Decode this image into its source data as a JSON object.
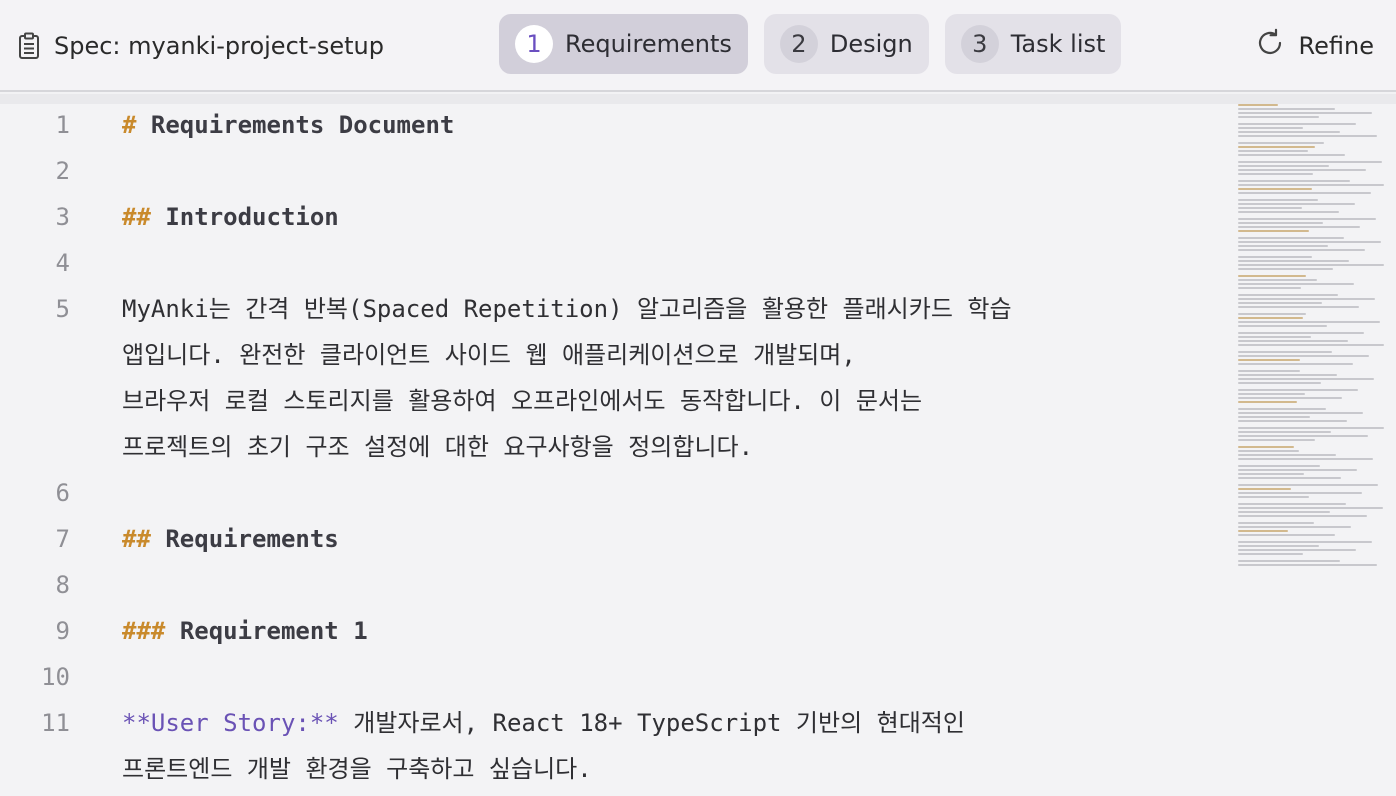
{
  "header": {
    "spec_label": "Spec: myanki-project-setup",
    "steps": [
      {
        "num": "1",
        "label": "Requirements",
        "active": true
      },
      {
        "num": "2",
        "label": "Design",
        "active": false
      },
      {
        "num": "3",
        "label": "Task list",
        "active": false
      }
    ],
    "refine_label": "Refine"
  },
  "editor": {
    "line_numbers": [
      "1",
      "2",
      "3",
      "4",
      "5",
      "6",
      "7",
      "8",
      "9",
      "10",
      "11"
    ],
    "lines": {
      "l1_marker": "#",
      "l1_text": "Requirements Document",
      "l3_marker": "##",
      "l3_text": "Introduction",
      "l5_a": "MyAnki는 간격 반복(Spaced Repetition) 알고리즘을 활용한 플래시카드 학습",
      "l5_b": "앱입니다. 완전한 클라이언트 사이드 웹 애플리케이션으로 개발되며,",
      "l5_c": "브라우저 로컬 스토리지를 활용하여 오프라인에서도 동작합니다. 이 문서는",
      "l5_d": "프로젝트의 초기 구조 설정에 대한 요구사항을 정의합니다.",
      "l7_marker": "##",
      "l7_text": "Requirements",
      "l9_marker": "###",
      "l9_text": "Requirement 1",
      "l11_bold": "**User Story:**",
      "l11_a": "개발자로서, React 18+ TypeScript 기반의 현대적인",
      "l11_b": "프론트엔드 개발 환경을 구축하고 싶습니다."
    }
  },
  "colors": {
    "markdown_marker": "#c98a2c",
    "bold_text": "#6a52b5",
    "active_step_number": "#6a4fc0"
  },
  "icons": {
    "spec": "clipboard-icon",
    "refine": "refresh-icon"
  }
}
